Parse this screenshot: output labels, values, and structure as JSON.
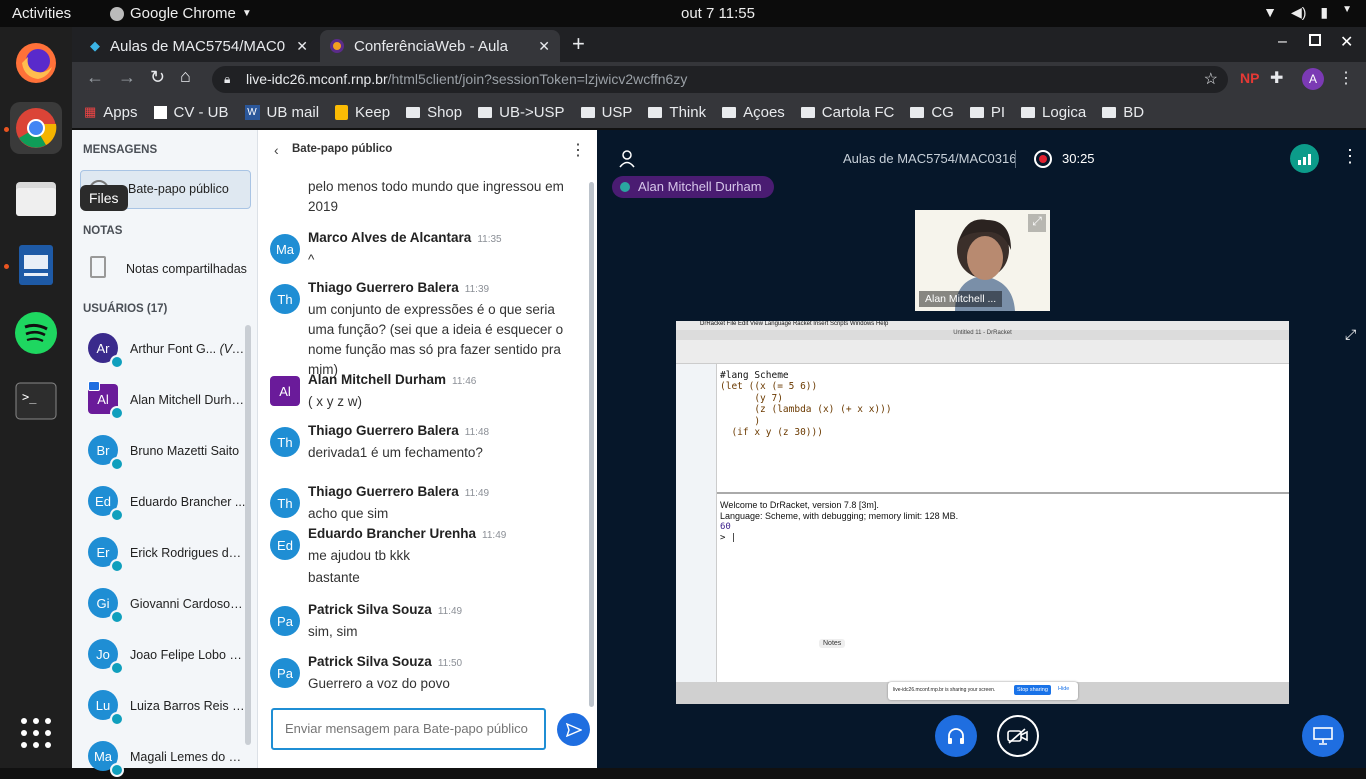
{
  "system": {
    "activities": "Activities",
    "app_name": "Google Chrome",
    "clock": "out 7  11:55"
  },
  "dock": {
    "tooltip": "Files"
  },
  "tabs": [
    {
      "title": "Aulas de MAC5754/MAC0",
      "active": false
    },
    {
      "title": "ConferênciaWeb - Aula",
      "active": true
    }
  ],
  "address": {
    "domain": "live-idc26.mconf.rnp.br",
    "path": "/html5client/join?sessionToken=lzjwicv2wcffn6zy",
    "profile_letter": "A"
  },
  "bookmarks": [
    "Apps",
    "CV - UB",
    "UB mail",
    "Keep",
    "Shop",
    "UB->USP",
    "USP",
    "Think",
    "Açoes",
    "Cartola FC",
    "CG",
    "PI",
    "Logica",
    "BD"
  ],
  "sidebar": {
    "messages_header": "MENSAGENS",
    "public_chat": "Bate-papo público",
    "notes_header": "NOTAS",
    "shared_notes": "Notas compartilhadas",
    "users_header": "USUÁRIOS (17)",
    "users": [
      {
        "initials": "Ar",
        "name": "Arthur Font G...",
        "you": "(Você)",
        "color": "#3a2a8c"
      },
      {
        "initials": "Al",
        "name": "Alan Mitchell Durham",
        "you": "",
        "color": "#6a1b9a"
      },
      {
        "initials": "Br",
        "name": "Bruno Mazetti Saito",
        "you": "",
        "color": "#1f8ed4"
      },
      {
        "initials": "Ed",
        "name": "Eduardo Brancher ...",
        "you": "",
        "color": "#1f8ed4"
      },
      {
        "initials": "Er",
        "name": "Erick Rodrigues de ...",
        "you": "",
        "color": "#1f8ed4"
      },
      {
        "initials": "Gi",
        "name": "Giovanni Cardoso d...",
        "you": "",
        "color": "#1f8ed4"
      },
      {
        "initials": "Jo",
        "name": "Joao Felipe Lobo P...",
        "you": "",
        "color": "#1f8ed4"
      },
      {
        "initials": "Lu",
        "name": "Luiza Barros Reis S...",
        "you": "",
        "color": "#1f8ed4"
      },
      {
        "initials": "Ma",
        "name": "Magali Lemes do Sa...",
        "you": "",
        "color": "#1f8ed4"
      }
    ]
  },
  "chat": {
    "title": "Bate-papo público",
    "placeholder": "Enviar mensagem para Bate-papo público",
    "partial_text": "pelo menos todo mundo que ingressou em 2019",
    "messages": [
      {
        "initials": "Ma",
        "name": "Marco Alves de Alcantara",
        "time": "11:35",
        "text": "^",
        "color": "#1f8ed4"
      },
      {
        "initials": "Th",
        "name": "Thiago Guerrero Balera",
        "time": "11:39",
        "text": "um conjunto de expressões é o que seria uma função? (sei que a ideia é esquecer o nome função mas só pra fazer sentido pra mim)",
        "color": "#1f8ed4"
      },
      {
        "initials": "Al",
        "name": "Alan Mitchell Durham",
        "time": "11:46",
        "text": "( x y z w)",
        "color": "#6a1b9a"
      },
      {
        "initials": "Th",
        "name": "Thiago Guerrero Balera",
        "time": "11:48",
        "text": "derivada1 é um fechamento?",
        "color": "#1f8ed4"
      },
      {
        "initials": "Th",
        "name": "Thiago Guerrero Balera",
        "time": "11:49",
        "text": "acho que sim",
        "color": "#1f8ed4"
      },
      {
        "initials": "Ed",
        "name": "Eduardo Brancher Urenha",
        "time": "11:49",
        "text": "me ajudou tb kkk",
        "color": "#1f8ed4"
      },
      {
        "initials": "",
        "name": "",
        "time": "",
        "text": "bastante",
        "color": ""
      },
      {
        "initials": "Pa",
        "name": "Patrick Silva Souza",
        "time": "11:49",
        "text": "sim, sim",
        "color": "#1f8ed4"
      },
      {
        "initials": "Pa",
        "name": "Patrick Silva Souza",
        "time": "11:50",
        "text": "Guerrero a voz do povo",
        "color": "#1f8ed4"
      }
    ]
  },
  "meeting": {
    "title": "Aulas de MAC5754/MAC0316",
    "timer": "30:25",
    "talker": "Alan Mitchell Durham",
    "webcam_label": "Alan Mitchell ..."
  },
  "shared_screen": {
    "code": [
      "#lang Scheme",
      "(let ((x (= 5 6))",
      "      (y 7)",
      "      (z (lambda (x) (+ x x)))",
      "      )",
      "  (if x y (z 30)))"
    ],
    "repl_welcome": "Welcome to DrRacket, version 7.8 [3m].",
    "repl_language": "Language: Scheme, with debugging; memory limit: 128 MB.",
    "repl_result": "60",
    "repl_prompt": "> |",
    "sharing_notice": "live-idc26.mconf.rnp.br is sharing your screen.",
    "stop_sharing": "Stop sharing",
    "hide": "Hide",
    "notes_label": "Notes",
    "menubar": "DrRacket   File   Edit   View   Language   Racket   Insert   Scripts   Windows   Help",
    "window_title": "Untitled 11 - DrRacket"
  },
  "colors": {
    "chrome_dark": "#202124",
    "meeting_bg": "#06172a",
    "accent_blue": "#1f8ed4",
    "talker_purple": "#4a1c72",
    "record_red": "#e0202f"
  }
}
